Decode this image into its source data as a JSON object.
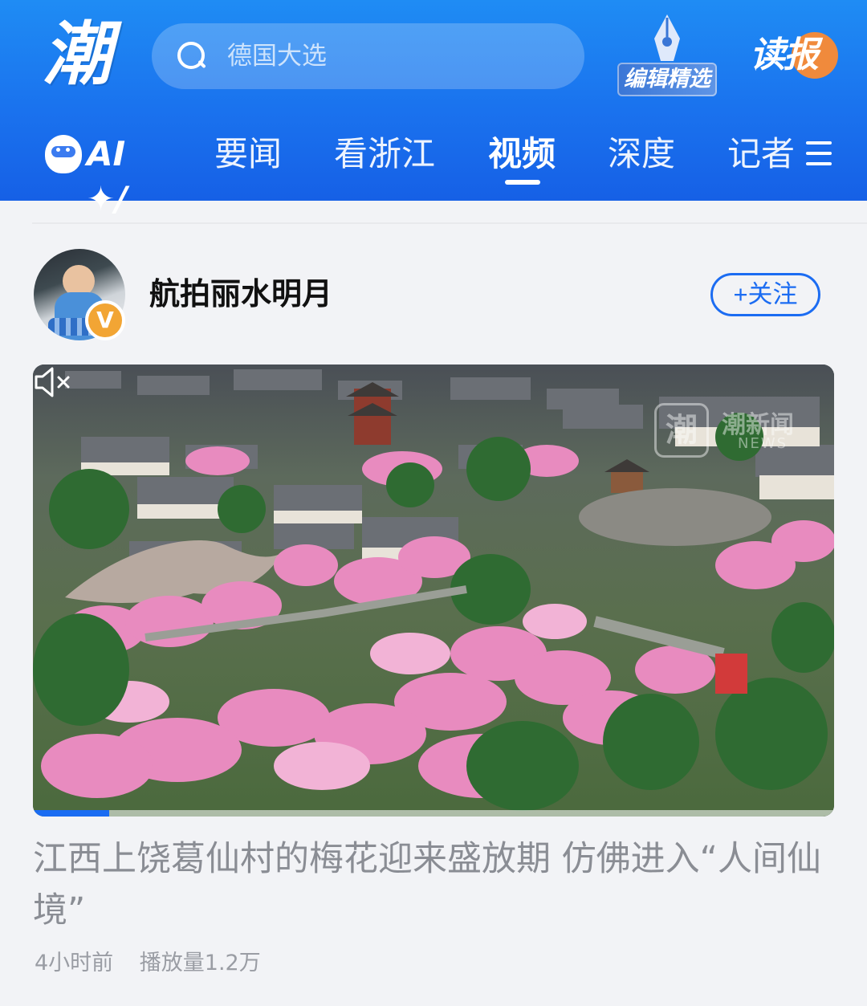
{
  "header": {
    "logo_text": "潮",
    "search": {
      "placeholder": "德国大选"
    },
    "editor_pick_label": "编辑精选",
    "read_paper_label": "读报",
    "nav": {
      "ai_label": "AI",
      "tabs": [
        {
          "label": "要闻",
          "active": false
        },
        {
          "label": "看浙江",
          "active": false
        },
        {
          "label": "视频",
          "active": true
        },
        {
          "label": "深度",
          "active": false
        },
        {
          "label": "记者",
          "active": false
        }
      ]
    },
    "colors": {
      "header_top": "#1f8cf4",
      "header_bottom": "#1660e6"
    }
  },
  "post": {
    "author": {
      "name": "航拍丽水明月",
      "verified_badge": "V"
    },
    "follow_label": "+关注",
    "video": {
      "watermark_logo": "潮",
      "watermark_text": "潮新闻",
      "watermark_sub": "NEWS",
      "muted": true,
      "progress_fraction": 0.095
    },
    "title": "江西上饶葛仙村的梅花迎来盛放期 仿佛进入“人间仙境”",
    "time_ago": "4小时前",
    "play_count": "播放量1.2万"
  },
  "accent_color": "#1b6cf2"
}
